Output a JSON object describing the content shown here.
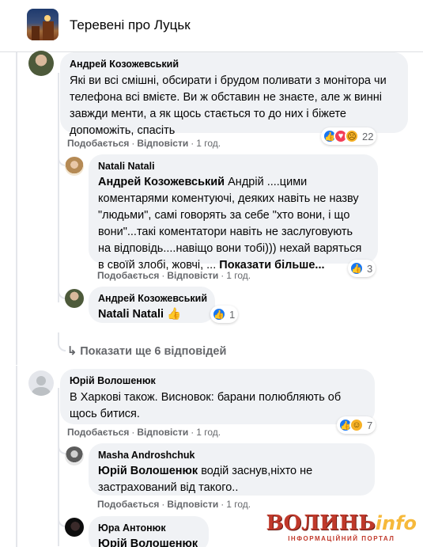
{
  "group": {
    "title": "Теревені про Луцьк"
  },
  "actions": {
    "like": "Подобається",
    "reply": "Відповісти",
    "sep": "·"
  },
  "comments": [
    {
      "author": "Андрей Козожевський",
      "text": "Які ви всі смішні, обсирати і брудом поливати з монітора чи телефона всі вмієте. Ви ж обставин не знаєте, але ж винні завжди менти, а як щось стається то до них і біжете допоможіть, спасіть",
      "time": "1 год.",
      "reactions": {
        "icons": [
          "like-icon",
          "love-icon",
          "sad-icon"
        ],
        "count": "22"
      }
    },
    {
      "author": "Natali Natali",
      "mention": "Андрей Козожевський",
      "text": " Андрій ....цими коментарями коментуючі, деяких навіть не назву \"людьми\", самі говорять за себе \"хто вони, і що вони\"...такі коментатори навіть не заслуговують на відповідь....навіщо вони тобі))) нехай варяться в своїй злобі, жовчі, ...",
      "see_more": "Показати більше...",
      "time": "1 год.",
      "reactions": {
        "icons": [
          "like-icon"
        ],
        "count": "3"
      }
    },
    {
      "author": "Андрей Козожевський",
      "mention": "Natali Natali",
      "emoji": "👍",
      "reactions": {
        "icons": [
          "like-icon"
        ],
        "count": "1"
      }
    },
    {
      "more_replies": "Показати ще 6 відповідей"
    },
    {
      "author": "Юрій Волошенюк",
      "text": "В Харкові також. Висновок: барани полюбляють об щось битися.",
      "time": "1 год.",
      "reactions": {
        "icons": [
          "like-icon",
          "haha-icon"
        ],
        "count": "7"
      }
    },
    {
      "author": "Masha Androshchuk",
      "mention": "Юрій Волошенюк",
      "text": " водій заснув,ніхто не застрахований від такого..",
      "time": "1 год."
    },
    {
      "author": "Юра Антонюк",
      "mention": "Юрій Волошенюк"
    }
  ],
  "watermark": {
    "part1": "ВОЛИНЬ",
    "part2": "info",
    "subtitle": "ІНФОРМАЦІЙНИЙ ПОРТАЛ"
  },
  "colors": {
    "like": "#1877f2",
    "bubble": "#f0f2f5",
    "meta": "#65676b",
    "watermark": "#c0392b"
  }
}
